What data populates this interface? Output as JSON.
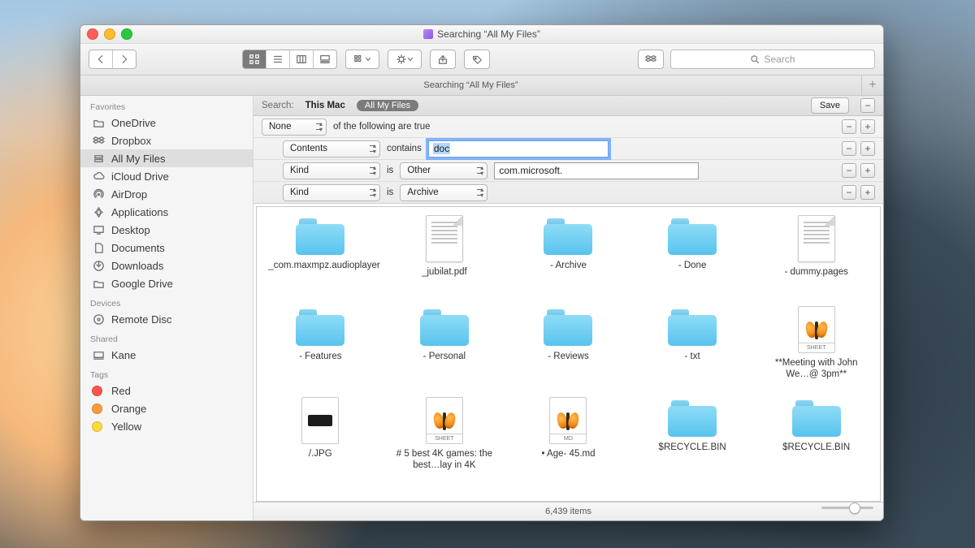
{
  "window": {
    "title": "Searching “All My Files”"
  },
  "toolbar": {
    "search_placeholder": "Search"
  },
  "tabbar": {
    "tab_label": "Searching “All My Files”"
  },
  "sidebar": {
    "sections": {
      "favorites": "Favorites",
      "devices": "Devices",
      "shared": "Shared",
      "tags": "Tags"
    },
    "favorites": [
      {
        "label": "OneDrive",
        "icon": "folder"
      },
      {
        "label": "Dropbox",
        "icon": "dropbox"
      },
      {
        "label": "All My Files",
        "icon": "allmyfiles",
        "selected": true
      },
      {
        "label": "iCloud Drive",
        "icon": "cloud"
      },
      {
        "label": "AirDrop",
        "icon": "airdrop"
      },
      {
        "label": "Applications",
        "icon": "apps"
      },
      {
        "label": "Desktop",
        "icon": "desktop"
      },
      {
        "label": "Documents",
        "icon": "documents"
      },
      {
        "label": "Downloads",
        "icon": "downloads"
      },
      {
        "label": "Google Drive",
        "icon": "folder"
      }
    ],
    "devices": [
      {
        "label": "Remote Disc",
        "icon": "disc"
      }
    ],
    "shared": [
      {
        "label": "Kane",
        "icon": "computer"
      }
    ],
    "tags": [
      {
        "label": "Red",
        "color": "#ff5350"
      },
      {
        "label": "Orange",
        "color": "#ff9a38"
      },
      {
        "label": "Yellow",
        "color": "#ffd93b"
      }
    ]
  },
  "scope": {
    "label": "Search:",
    "this_mac": "This Mac",
    "all_my_files": "All My Files",
    "save": "Save"
  },
  "criteria": {
    "root": {
      "popup": "None",
      "text": "of the following are true"
    },
    "rows": [
      {
        "attr": "Contents",
        "op": "contains",
        "input": "doc",
        "focused": true
      },
      {
        "attr": "Kind",
        "op": "is",
        "val_popup": "Other",
        "input": "com.microsoft."
      },
      {
        "attr": "Kind",
        "op": "is",
        "val_popup": "Archive"
      }
    ]
  },
  "results": [
    {
      "name": "_com.maxmpz.audioplayer",
      "kind": "folder"
    },
    {
      "name": "_jubilat.pdf",
      "kind": "pdf"
    },
    {
      "name": "- Archive",
      "kind": "folder"
    },
    {
      "name": "- Done",
      "kind": "folder"
    },
    {
      "name": "- dummy.pages",
      "kind": "pages"
    },
    {
      "name": "- Features",
      "kind": "folder"
    },
    {
      "name": "- Personal",
      "kind": "folder"
    },
    {
      "name": "- Reviews",
      "kind": "folder"
    },
    {
      "name": "- txt",
      "kind": "folder"
    },
    {
      "name": "**Meeting with John We…@ 3pm**",
      "kind": "sheet"
    },
    {
      "name": "/.JPG",
      "kind": "jpg"
    },
    {
      "name": "# 5 best 4K games: the best…lay in 4K",
      "kind": "sheet"
    },
    {
      "name": "• Age- 45.md",
      "kind": "md"
    },
    {
      "name": "$RECYCLE.BIN",
      "kind": "folder"
    },
    {
      "name": "$RECYCLE.BIN",
      "kind": "folder"
    }
  ],
  "status": {
    "count": "6,439 items"
  }
}
